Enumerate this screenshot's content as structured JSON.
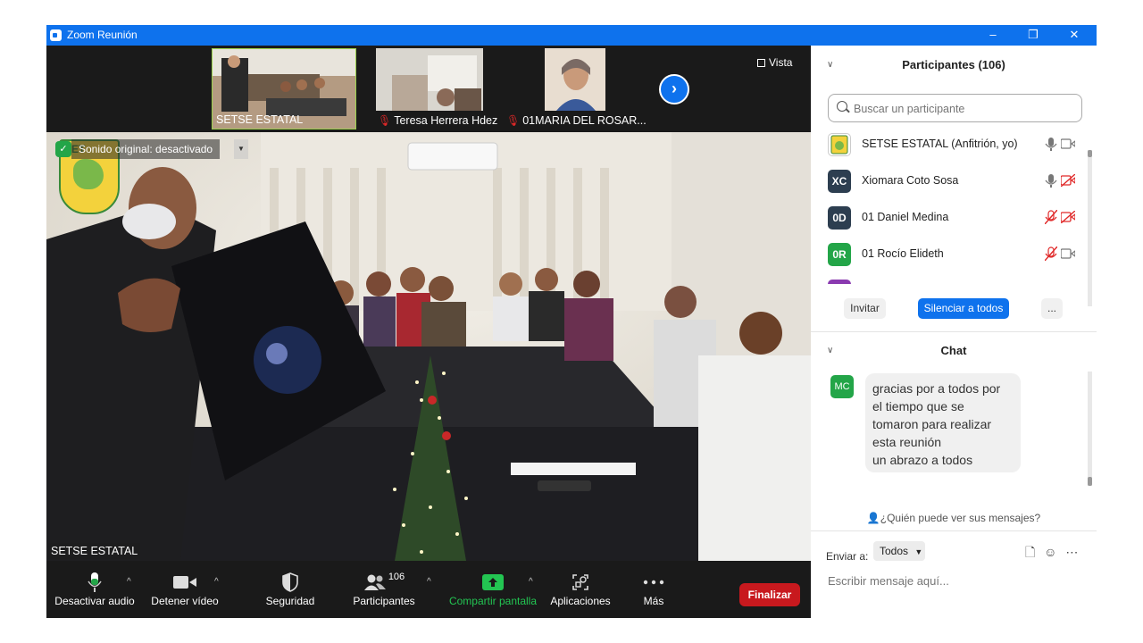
{
  "window": {
    "title": "Zoom Reunión",
    "controls": {
      "minimize": "–",
      "restore": "❐",
      "close": "✕"
    }
  },
  "video_strip": {
    "thumbnails": [
      {
        "name": "SETSE ESTATAL",
        "muted": false
      },
      {
        "name": "Teresa Herrera Hdez",
        "muted": true
      },
      {
        "name": "01MARIA DEL ROSAR...",
        "muted": true
      }
    ],
    "next_button": "›",
    "view_label": "Vista"
  },
  "main_video": {
    "speaker_name": "SETSE ESTATAL",
    "original_audio_label": "Sonido original: desactivado",
    "logo_text": "ET"
  },
  "toolbar": {
    "mute": "Desactivar audio",
    "video": "Detener vídeo",
    "security": "Seguridad",
    "participants": "Participantes",
    "participants_count": "106",
    "share": "Compartir pantalla",
    "apps": "Aplicaciones",
    "more": "Más",
    "end": "Finalizar"
  },
  "participants_panel": {
    "title": "Participantes (106)",
    "search_placeholder": "Buscar un participante",
    "list": [
      {
        "initials": "",
        "name": "SETSE ESTATAL (Anfitrión, yo)",
        "avatar_color": "#ffffff",
        "mic_muted": false,
        "cam_off": false
      },
      {
        "initials": "XC",
        "name": "Xiomara Coto Sosa",
        "avatar_color": "#2d3e50",
        "mic_muted": false,
        "cam_off": true
      },
      {
        "initials": "0D",
        "name": "01 Daniel Medina",
        "avatar_color": "#2d3e50",
        "mic_muted": true,
        "cam_off": true
      },
      {
        "initials": "0R",
        "name": "01 Rocío Elideth",
        "avatar_color": "#23a548",
        "mic_muted": true,
        "cam_off": false
      }
    ],
    "invite": "Invitar",
    "mute_all": "Silenciar a todos",
    "more": "..."
  },
  "chat_panel": {
    "title": "Chat",
    "message": {
      "sender_initials": "MC",
      "lines": [
        "gracias por a todos por",
        "el tiempo que se",
        "tomaron para realizar",
        "esta reunión",
        "un abrazo a todos"
      ]
    },
    "who_can_see": "¿Quién puede ver sus mensajes?",
    "send_to_label": "Enviar a:",
    "send_to_value": "Todos",
    "input_placeholder": "Escribir mensaje aquí..."
  }
}
